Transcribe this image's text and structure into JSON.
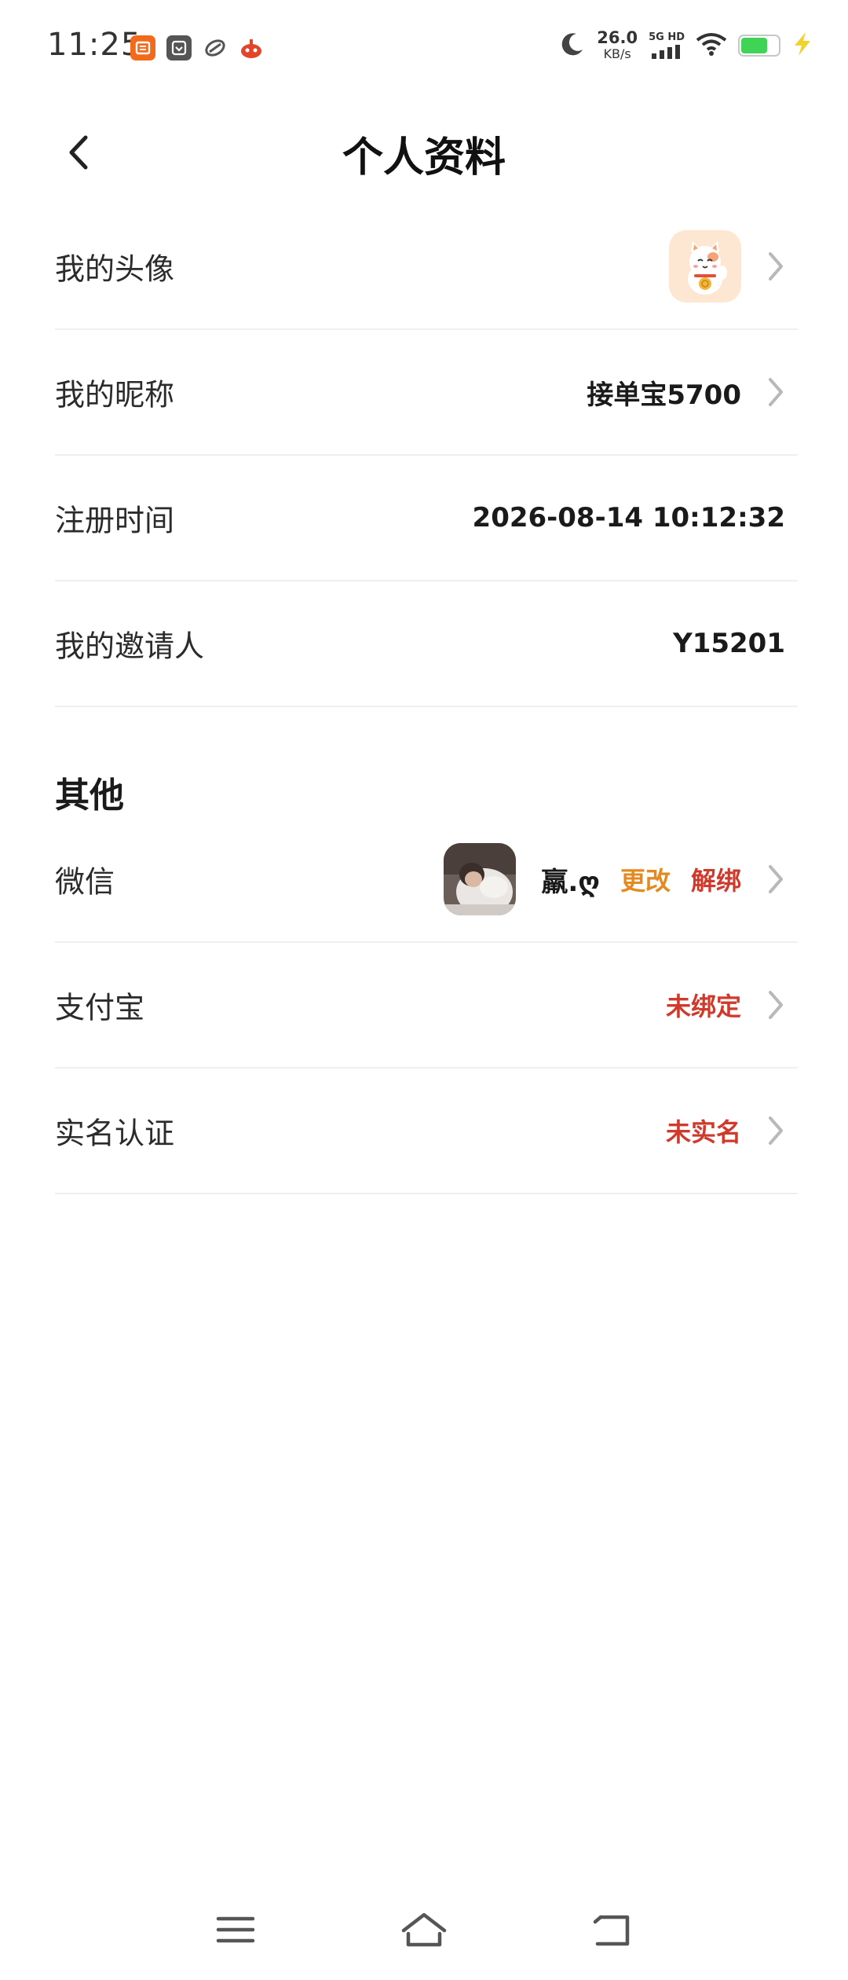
{
  "status_bar": {
    "time": "11:25",
    "net_speed_value": "26.0",
    "net_speed_unit": "KB/s",
    "signal_text": "5G HD",
    "notification_icons": [
      "taobao-icon",
      "message-box-icon",
      "feather-app-icon",
      "game-app-icon"
    ],
    "battery_level": 0.72
  },
  "header": {
    "title": "个人资料"
  },
  "profile": {
    "avatar_label": "我的头像",
    "nickname_label": "我的昵称",
    "nickname_value": "接单宝5700",
    "register_label": "注册时间",
    "register_value": "2026-08-14 10:12:32",
    "inviter_label": "我的邀请人",
    "inviter_value": "Y15201"
  },
  "other": {
    "section_title": "其他",
    "wechat_label": "微信",
    "wechat_name": "羸.ღ",
    "wechat_change": "更改",
    "wechat_unbind": "解绑",
    "alipay_label": "支付宝",
    "alipay_value": "未绑定",
    "realname_label": "实名认证",
    "realname_value": "未实名"
  },
  "colors": {
    "change_orange": "#e48a1e",
    "alert_red": "#d03a2c",
    "divider": "#efefef"
  }
}
